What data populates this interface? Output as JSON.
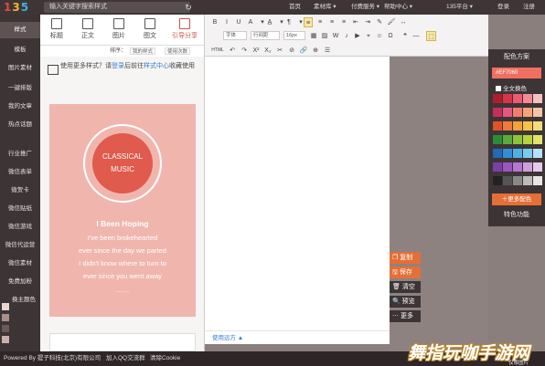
{
  "header": {
    "logo_letters": [
      "1",
      "3",
      "5"
    ],
    "search_placeholder": "输入关键字搜索样式",
    "nav": [
      "首页",
      "素材库 ▾",
      "付费服务 ▾",
      "帮助中心 ▾",
      "135平台 ▾",
      "登录",
      "注册"
    ]
  },
  "sidebar": {
    "items": [
      "样式",
      "模板",
      "图片素材",
      "一键排版",
      "我的文章",
      "热点话题",
      "行业推广",
      "微信表单",
      "微贺卡",
      "微信贴纸",
      "微信游戏",
      "微信代运营",
      "微信素材",
      "免费加粉",
      "换主题色"
    ]
  },
  "template_panel": {
    "tabs": [
      "标题",
      "正文",
      "图片",
      "图文",
      "引导分享"
    ],
    "sort_label": "排序：",
    "sort_chips": [
      "我的样式",
      "使用次数"
    ],
    "notice_text": "使用更多样式？请",
    "notice_link1": "登录",
    "notice_mid": "后前往",
    "notice_link2": "样式中心",
    "notice_tail": "收藏使用",
    "card": {
      "circle_line1": "CLASSICAL",
      "circle_line2": "MUSIC",
      "song_title": "I Been Hoping",
      "lyrics": [
        "I've been brokehearted",
        "ever since the day we parted",
        "I didn't know where to turn to",
        "ever since you went away",
        "……"
      ]
    }
  },
  "editor": {
    "toolbar_row1": [
      "B",
      "I",
      "U",
      "A",
      "▾",
      "A̲",
      "▾",
      "¶",
      "▾",
      "≡",
      "≡",
      "≡",
      "≡",
      "⇤",
      "⇥",
      "✎",
      "🖌",
      "↔"
    ],
    "font_family": "字体",
    "line_height": "行间距",
    "font_size": "16px",
    "toolbar_row3": [
      "HTML",
      "↶",
      "↷",
      "X²",
      "X₂",
      "✂",
      "⊘",
      "🔗",
      "⊕",
      "☰"
    ],
    "footer_link": "使用远方 ▲"
  },
  "actions": [
    "复制",
    "保存",
    "清空",
    "预览",
    "更多"
  ],
  "color_panel": {
    "title": "配色方案",
    "hex": "#EF7060",
    "all_label": "全文换色",
    "swatches": [
      "#b01e2b",
      "#d9344a",
      "#ee5b6f",
      "#f58a94",
      "#f6c1c1",
      "#c42e5b",
      "#e25881",
      "#f47c6c",
      "#f5a37a",
      "#f0c5a8",
      "#e3512a",
      "#f07a3a",
      "#f2a23a",
      "#f6c34a",
      "#f3dc7c",
      "#2a8c3a",
      "#58ad3a",
      "#8cc43a",
      "#b8d33d",
      "#dfe46a",
      "#1e6bb8",
      "#2e8fd6",
      "#4fb0e6",
      "#7acbf0",
      "#b5e2f6",
      "#7a3fa8",
      "#9b56c0",
      "#b577d0",
      "#cf9fdd",
      "#e6c8ee",
      "#222222",
      "#555555",
      "#888888",
      "#bbbbbb",
      "#e6e6e6"
    ],
    "more_label": "更多配色",
    "special_label": "特色功能"
  },
  "footer": {
    "text": "Powered By 提子科技(北京)有限公司",
    "qq": "加入QQ交流群",
    "cookie": "清除Cookie"
  },
  "watermark": {
    "text": "舞指玩咖手游网",
    "sub": "仅限图片"
  }
}
